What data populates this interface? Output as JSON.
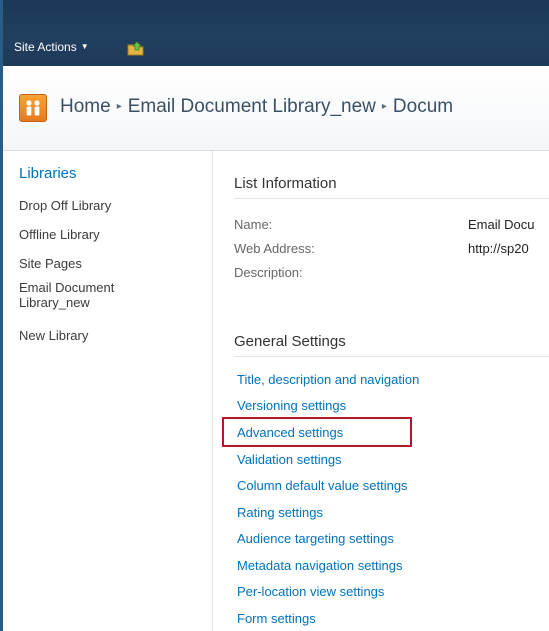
{
  "topbar": {
    "site_actions_label": "Site Actions",
    "caret": "▼",
    "navigate_up_icon": "folder-arrow-up-icon"
  },
  "header": {
    "logo_icon": "sharepoint-people-logo-icon",
    "breadcrumb": [
      "Home",
      "Email Document Library_new",
      "Docum"
    ],
    "separator": "▸"
  },
  "quick_launch": {
    "heading": "Libraries",
    "items": [
      "Drop Off Library",
      "Offline Library",
      "Site Pages",
      "Email Document",
      "Library_new",
      "New Library"
    ]
  },
  "list_information": {
    "title": "List Information",
    "rows": [
      {
        "label": "Name:",
        "value": "Email Docu"
      },
      {
        "label": "Web Address:",
        "value": "http://sp20"
      },
      {
        "label": "Description:",
        "value": ""
      }
    ]
  },
  "general_settings": {
    "title": "General Settings",
    "links": [
      "Title, description and navigation",
      "Versioning settings",
      "Advanced settings",
      "Validation settings",
      "Column default value settings",
      "Rating settings",
      "Audience targeting settings",
      "Metadata navigation settings",
      "Per-location view settings",
      "Form settings"
    ],
    "highlighted_link": "Advanced settings"
  },
  "colors": {
    "topbar": "#1e3a59",
    "link": "#0072bc",
    "highlight_border": "#b2182b",
    "logo": "#f08a24"
  }
}
